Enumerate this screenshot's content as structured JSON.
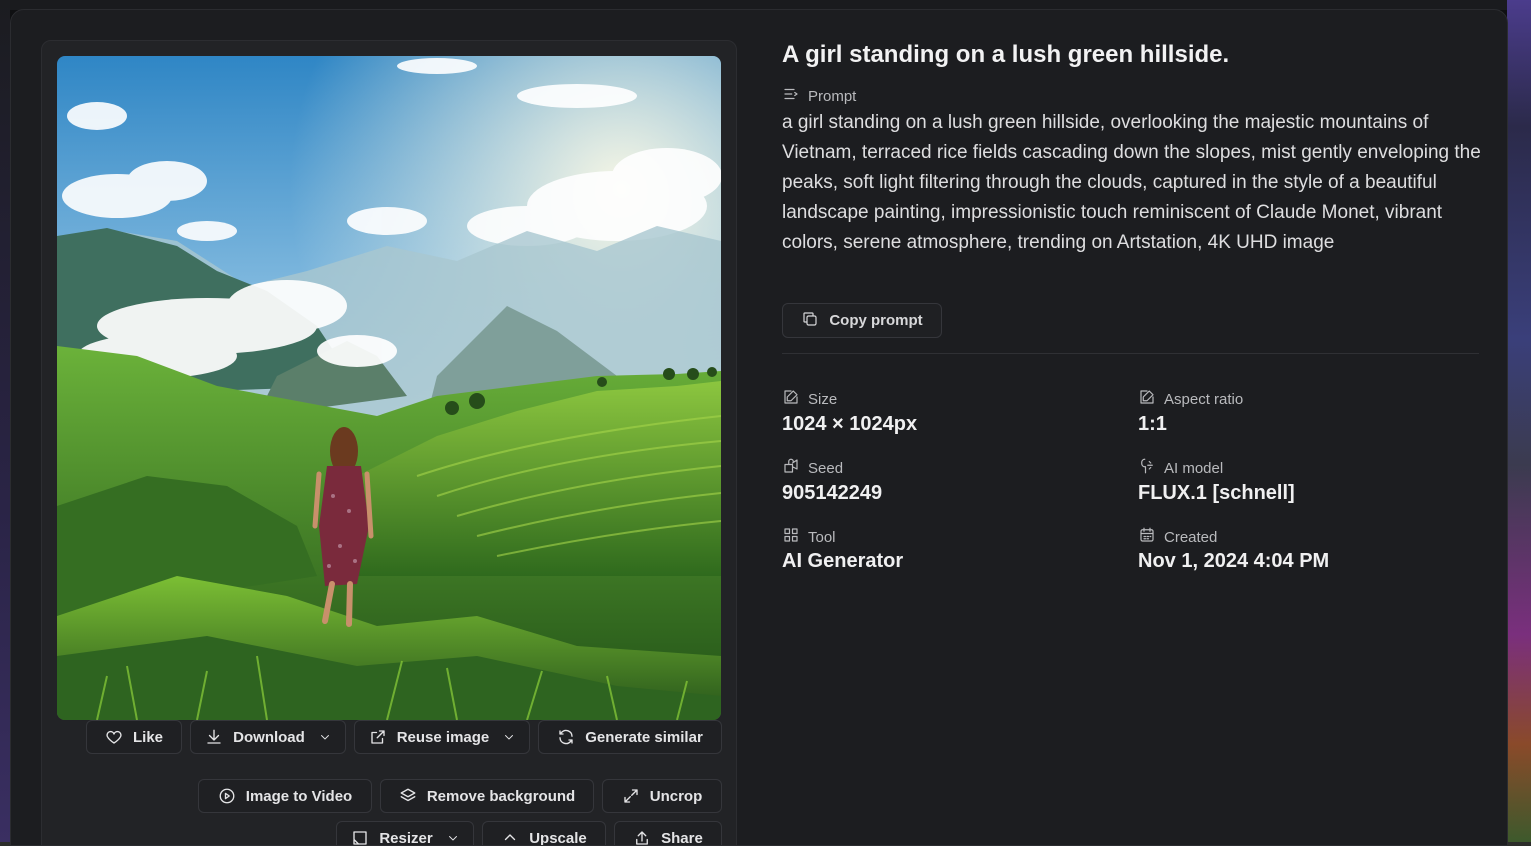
{
  "image": {
    "subject": "girl-on-green-hillside"
  },
  "actions": {
    "like": "Like",
    "download": "Download",
    "reuse_image": "Reuse image",
    "generate_similar": "Generate similar",
    "image_to_video": "Image to Video",
    "remove_background": "Remove background",
    "uncrop": "Uncrop",
    "resizer": "Resizer",
    "upscale": "Upscale",
    "share": "Share"
  },
  "details": {
    "title": "A girl standing on a lush green hillside.",
    "prompt_label": "Prompt",
    "prompt": "a girl standing on a lush green hillside, overlooking the majestic mountains of Vietnam, terraced rice fields cascading down the slopes, mist gently enveloping the peaks, soft light filtering through the clouds, captured in the style of a beautiful landscape painting, impressionistic touch reminiscent of Claude Monet, vibrant colors, serene atmosphere, trending on Artstation, 4K UHD image",
    "copy_prompt": "Copy prompt"
  },
  "meta": {
    "size_label": "Size",
    "size_value": "1024 × 1024px",
    "aspect_label": "Aspect ratio",
    "aspect_value": "1:1",
    "seed_label": "Seed",
    "seed_value": "905142249",
    "model_label": "AI model",
    "model_value": "FLUX.1 [schnell]",
    "tool_label": "Tool",
    "tool_value": "AI Generator",
    "created_label": "Created",
    "created_value": "Nov 1, 2024 4:04 PM"
  },
  "colors": {
    "background": "#1c1d20",
    "panel": "#222326",
    "button_border": "#35363b",
    "text": "#f0f0f1"
  }
}
